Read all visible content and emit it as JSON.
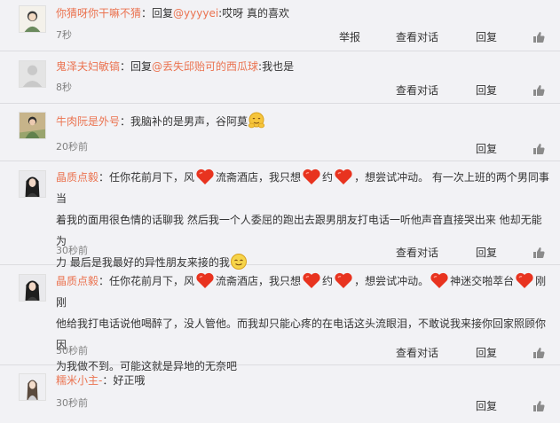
{
  "comments": [
    {
      "user": "你猜呀你干嘛不猜",
      "reply_prefix": "：回复",
      "mention": "@yyyyei",
      "text": ":哎呀 真的喜欢",
      "time": "7秒",
      "actions": [
        "举报",
        "查看对话",
        "回复"
      ]
    },
    {
      "user": "鬼泽夫妇敏镐",
      "reply_prefix": "：回复",
      "mention": "@丢失邱贻可的西瓜球",
      "text": ":我也是",
      "time": "8秒",
      "actions": [
        "查看对话",
        "回复"
      ]
    },
    {
      "user": "牛肉阮是外号",
      "text": "：我脑补的是男声，谷阿莫",
      "emoji_after": "hug-face",
      "time": "20秒前",
      "actions": [
        "回复"
      ]
    },
    {
      "user": "晶质点毅",
      "t1": "：任你花前月下，风",
      "t2": "流斋酒店，我只想",
      "t3": "约",
      "t4": "，想尝试冲动。 有一次上班的两个男同事当",
      "line2": "着我的面用很色情的话聊我 然后我一个人委屈的跑出去跟男朋友打电话一听他声音直接哭出来 他却无能为",
      "line3": "力 最后是我最好的异性朋友来接的我",
      "time": "30秒前",
      "actions": [
        "查看对话",
        "回复"
      ]
    },
    {
      "user": "晶质点毅",
      "t1": "：任你花前月下，风",
      "t2": "流斋酒店，我只想",
      "t3": "约",
      "t4": "，想尝试冲动。",
      "t5": "神迷交啪萃台",
      "t6": "刚刚",
      "line2": "他给我打电话说他喝醉了，没人管他。而我却只能心疼的在电话这头流眼泪，不敢说我来接你回家照顾你因",
      "line3": "为我做不到。可能这就是异地的无奈吧",
      "time": "30秒前",
      "actions": [
        "查看对话",
        "回复"
      ]
    },
    {
      "user": "糯米小主-",
      "text": "：好正哦",
      "time": "30秒前",
      "actions": [
        "回复"
      ]
    }
  ],
  "colors": {
    "username": "#eb7350",
    "bg": "#f2f2f5",
    "heart": "#e8331f"
  }
}
